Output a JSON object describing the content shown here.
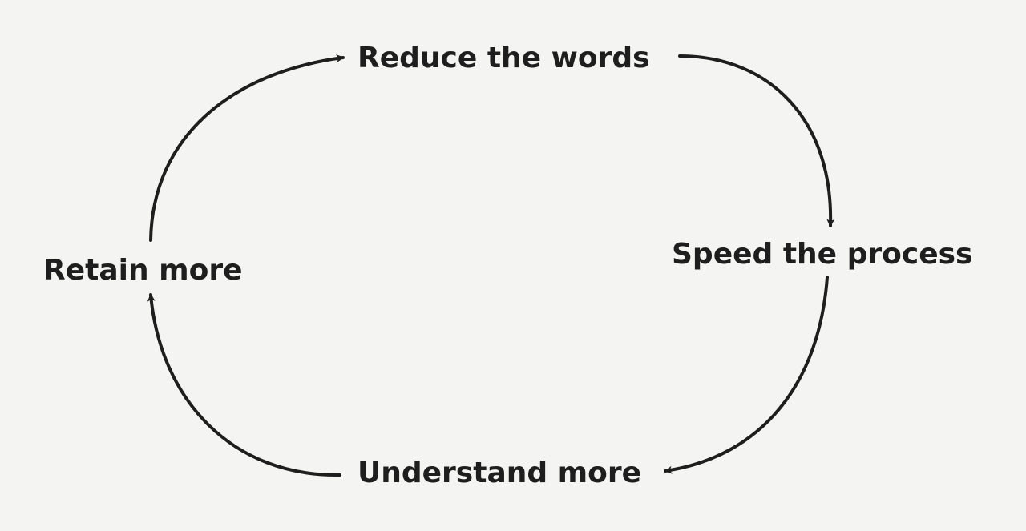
{
  "diagram": {
    "nodes": {
      "top": "Reduce the words",
      "right": "Speed the process",
      "bottom": "Understand more",
      "left": "Retain more"
    },
    "colors": {
      "background": "#f4f4f2",
      "text": "#1e1e1e",
      "arrow": "#1e1e1e"
    }
  }
}
